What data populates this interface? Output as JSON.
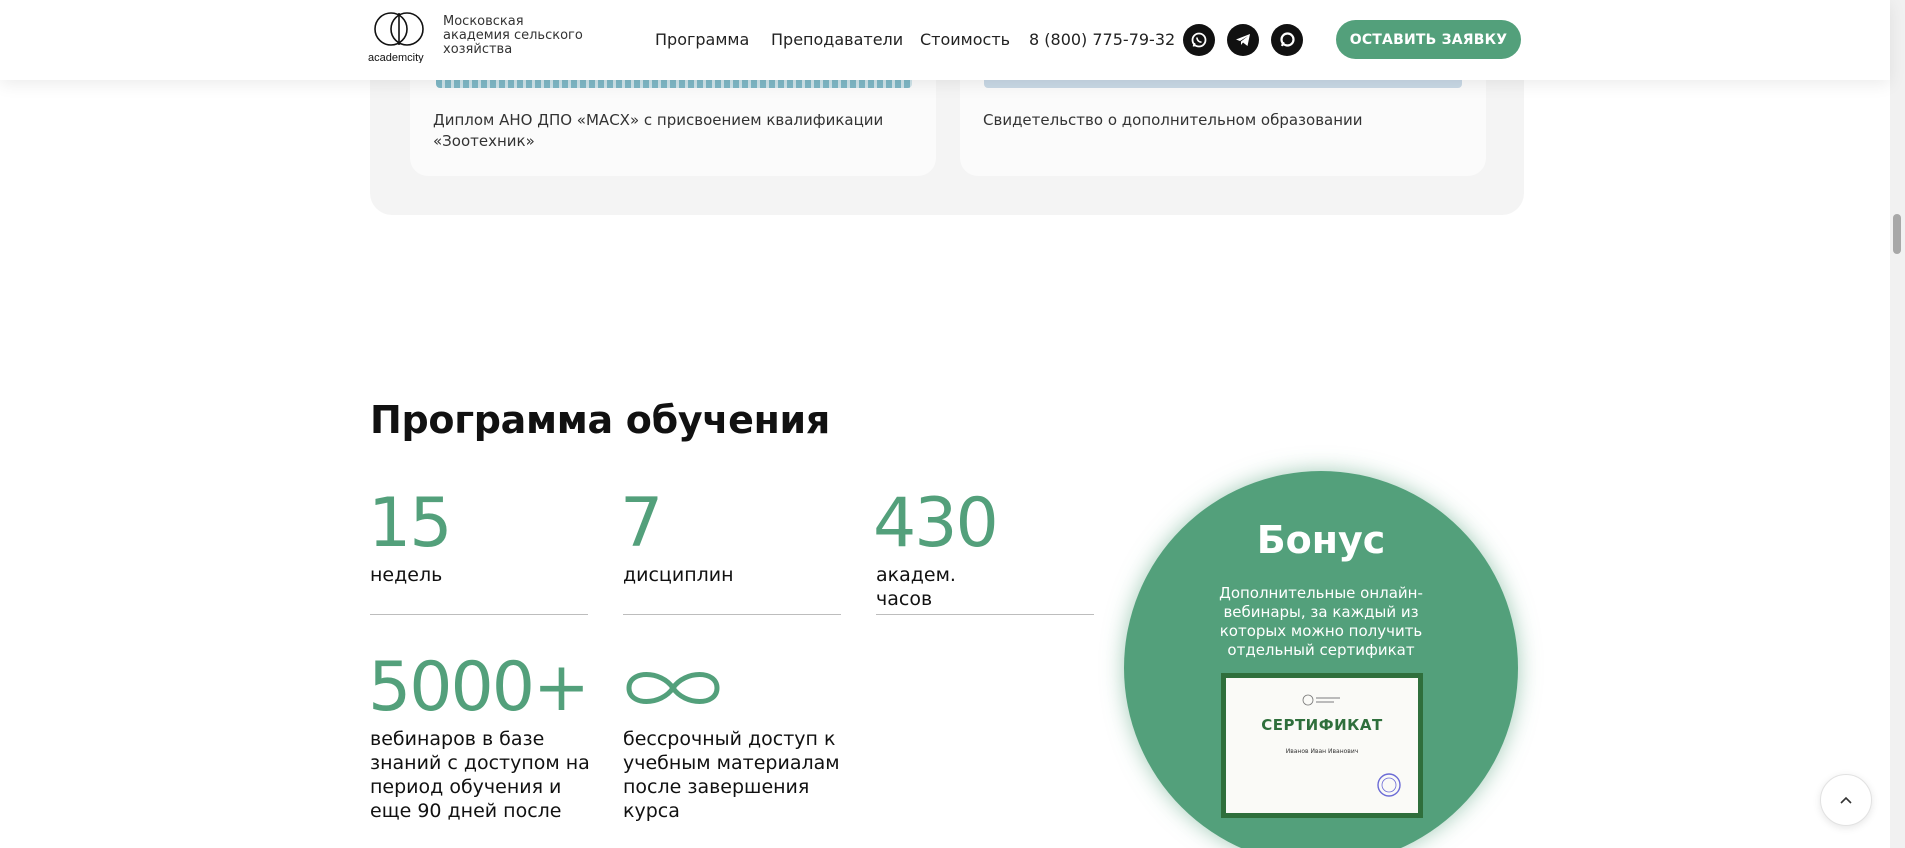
{
  "header": {
    "logo_text": "academcity",
    "academy_name": "Московская академия сельского хозяйства",
    "nav": [
      "Программа",
      "Преподаватели",
      "Стоимость"
    ],
    "phone": "8 (800) 775-79-32",
    "socials": [
      "whatsapp-icon",
      "telegram-icon",
      "chat-icon"
    ],
    "cta_label": "ОСТАВИТЬ ЗАЯВКУ"
  },
  "documents": [
    {
      "caption": "Диплом АНО ДПО «МАСХ» с присвоением квалификации «Зоотехник»"
    },
    {
      "caption": "Свидетельство о дополнительном образовании"
    }
  ],
  "program": {
    "title": "Программа обучения",
    "stats": [
      {
        "value": "15",
        "label": "недель"
      },
      {
        "value": "7",
        "label": "дисциплин"
      },
      {
        "value": "430",
        "label": "академ. часов"
      },
      {
        "value": "5000+",
        "label": "вебинаров в базе знаний с доступом на период обучения и еще 90 дней после"
      },
      {
        "value": "∞",
        "label": "бессрочный доступ к учебным материалам после завершения курса"
      }
    ]
  },
  "bonus": {
    "title": "Бонус",
    "text": "Дополнительные онлайн-вебинары, за каждый из которых можно получить отдельный сертификат",
    "certificate_title": "СЕРТИФИКАТ",
    "certificate_name": "Иванов Иван Иванович"
  },
  "colors": {
    "accent": "#53a07b",
    "certificate": "#2f6f3c"
  }
}
